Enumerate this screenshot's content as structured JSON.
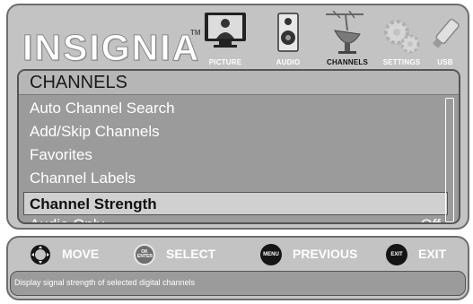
{
  "logo": {
    "text": "INSIGNIA",
    "tm": "TM"
  },
  "tabs": [
    {
      "id": "picture",
      "label": "PICTURE",
      "icon": "tv-picture-icon"
    },
    {
      "id": "audio",
      "label": "AUDIO",
      "icon": "speaker-icon"
    },
    {
      "id": "channels",
      "label": "CHANNELS",
      "icon": "satellite-dish-icon",
      "active": true
    },
    {
      "id": "settings",
      "label": "SETTINGS",
      "icon": "gears-icon"
    },
    {
      "id": "usb",
      "label": "USB",
      "icon": "usb-drive-icon"
    }
  ],
  "menu": {
    "title": "CHANNELS",
    "items": [
      {
        "label": "Auto Channel Search",
        "value": ""
      },
      {
        "label": "Add/Skip Channels",
        "value": ""
      },
      {
        "label": "Favorites",
        "value": ""
      },
      {
        "label": "Channel Labels",
        "value": ""
      },
      {
        "label": "Channel Strength",
        "value": "",
        "selected": true
      },
      {
        "label": "Audio Only",
        "value": "Off"
      }
    ]
  },
  "controls": [
    {
      "id": "move",
      "label": "MOVE",
      "icon": "dpad-icon",
      "icon_text": ""
    },
    {
      "id": "select",
      "label": "SELECT",
      "icon": "ok-enter-icon",
      "icon_text": "OK ENTER"
    },
    {
      "id": "previous",
      "label": "PREVIOUS",
      "icon": "menu-button-icon",
      "icon_text": "MENU"
    },
    {
      "id": "exit",
      "label": "EXIT",
      "icon": "exit-button-icon",
      "icon_text": "EXIT"
    }
  ],
  "help_text": "Display signal strength of selected digital channels",
  "colors": {
    "panel": "#c3c3c3",
    "list_background": "#9b9b9b",
    "selected_row": "#d0d0d0",
    "text_light": "#ffffff",
    "text_dark": "#111111"
  }
}
